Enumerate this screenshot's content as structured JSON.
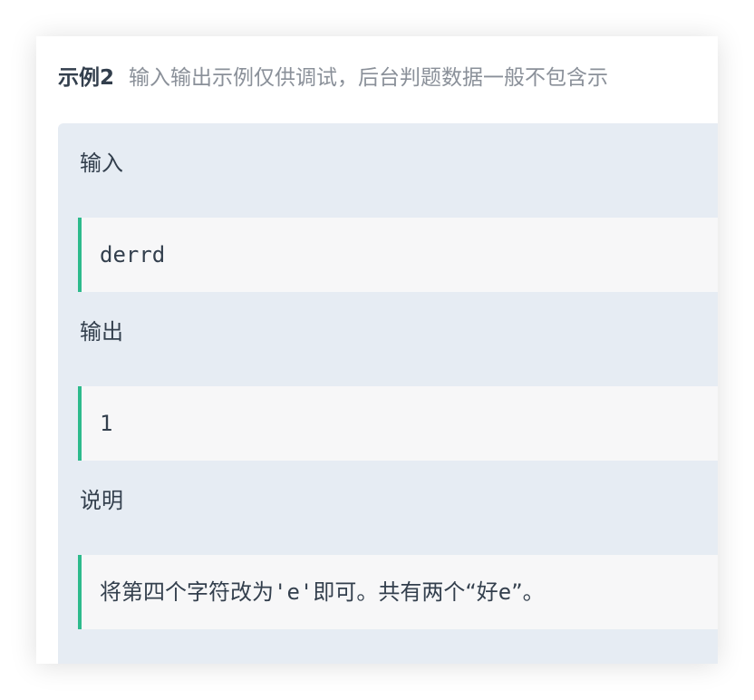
{
  "example": {
    "title": "示例2",
    "note": "输入输出示例仅供调试，后台判题数据一般不包含示"
  },
  "input": {
    "label": "输入",
    "value": "derrd"
  },
  "output": {
    "label": "输出",
    "value": "1"
  },
  "explanation": {
    "label": "说明",
    "text_before": "将第四个字符改为",
    "code_part": "'e'",
    "text_middle": "即可。共有两个“好",
    "code_part_2": "e",
    "text_after": "”。"
  },
  "colors": {
    "accent": "#2dba8c",
    "panel_bg": "#e6ecf3",
    "code_bg": "#f7f7f8",
    "text": "#333f4d",
    "muted": "#8a9099"
  }
}
